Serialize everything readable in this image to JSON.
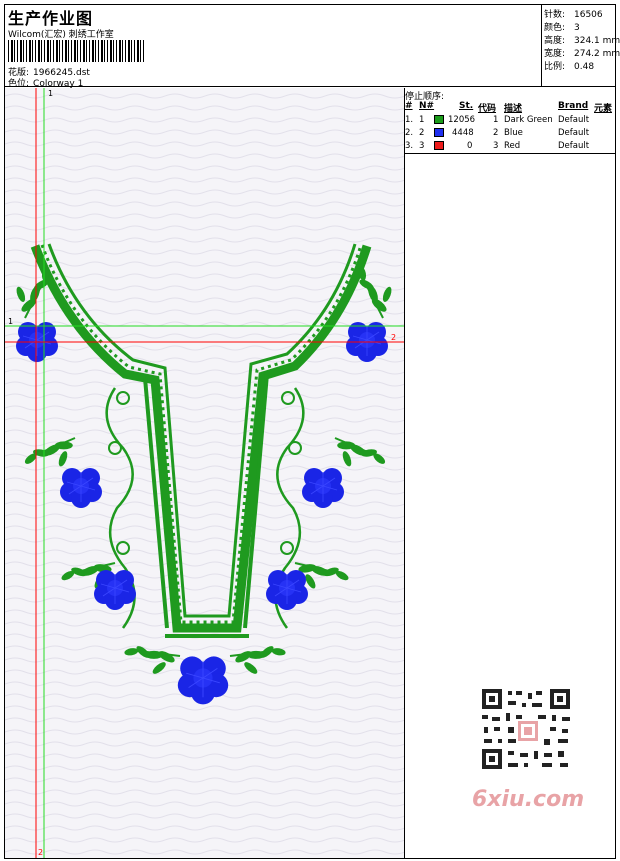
{
  "header": {
    "title": "生产作业图",
    "subtitle": "Wilcom(汇宏) 刺绣工作室",
    "design_label": "花版:",
    "design_value": "1966245.dst",
    "colorway_label": "色位:",
    "colorway_value": "Colorway 1"
  },
  "stats": [
    {
      "label": "针数:",
      "value": "16506"
    },
    {
      "label": "颜色:",
      "value": "3"
    },
    {
      "label": "高度:",
      "value": "324.1 mm"
    },
    {
      "label": "宽度:",
      "value": "274.2 mm"
    },
    {
      "label": "比例:",
      "value": "0.48"
    }
  ],
  "guides": {
    "v1": "1",
    "h1": "1",
    "h2": "2",
    "v2": "2"
  },
  "sequence": {
    "title": "停止顺序:",
    "columns": {
      "idx": "#",
      "no": "N#",
      "stitches": "St.",
      "code": "代码",
      "desc": "描述",
      "brand": "Brand",
      "elem": "元素"
    },
    "rows": [
      {
        "idx": "1.",
        "no": "1",
        "color": "#1a9b1a",
        "stitches": "12056",
        "code": "1",
        "desc": "Dark Green",
        "brand": "Default"
      },
      {
        "idx": "2.",
        "no": "2",
        "color": "#1f2ff0",
        "stitches": "4448",
        "code": "2",
        "desc": "Blue",
        "brand": "Default"
      },
      {
        "idx": "3.",
        "no": "3",
        "color": "#ee1c1c",
        "stitches": "0",
        "code": "3",
        "desc": "Red",
        "brand": "Default"
      }
    ]
  },
  "watermark": {
    "text": "6xiu.com"
  },
  "colors": {
    "green": "#1f9a1f",
    "blue": "#1a25e6",
    "red": "#ff0000",
    "guide_green": "#22dd22"
  }
}
